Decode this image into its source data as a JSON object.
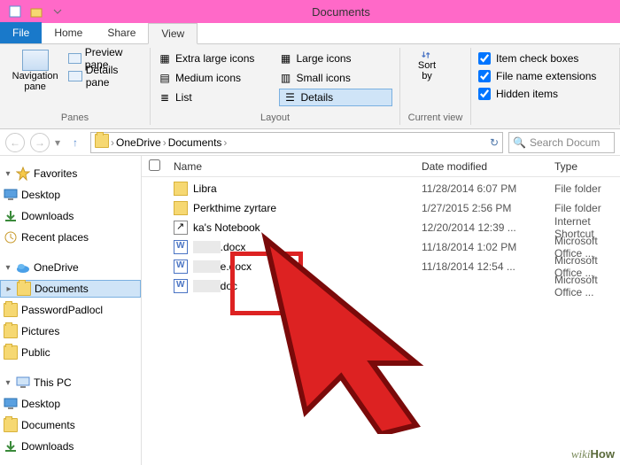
{
  "window_title": "Documents",
  "tabs": {
    "file": "File",
    "home": "Home",
    "share": "Share",
    "view": "View"
  },
  "ribbon": {
    "panes": {
      "nav": "Navigation\npane",
      "preview": "Preview pane",
      "details": "Details pane",
      "label": "Panes"
    },
    "layout": {
      "xl": "Extra large icons",
      "l": "Large icons",
      "m": "Medium icons",
      "s": "Small icons",
      "list": "List",
      "details": "Details",
      "label": "Layout"
    },
    "current": {
      "sort": "Sort\nby",
      "label": "Current view"
    },
    "show": {
      "itemcheck": "Item check boxes",
      "ext": "File name extensions",
      "hidden": "Hidden items"
    }
  },
  "breadcrumb": {
    "a": "OneDrive",
    "b": "Documents"
  },
  "search_placeholder": "Search Docum",
  "sidebar": {
    "favorites": "Favorites",
    "desktop": "Desktop",
    "downloads": "Downloads",
    "recent": "Recent places",
    "onedrive": "OneDrive",
    "documents": "Documents",
    "passpad": "PasswordPadlocl",
    "pictures": "Pictures",
    "public": "Public",
    "thispc": "This PC",
    "pc_desktop": "Desktop",
    "pc_documents": "Documents",
    "pc_downloads": "Downloads"
  },
  "columns": {
    "name": "Name",
    "date": "Date modified",
    "type": "Type"
  },
  "files": [
    {
      "icon": "folder",
      "name": "Libra",
      "date": "11/28/2014 6:07 PM",
      "type": "File folder"
    },
    {
      "icon": "folder",
      "name": "Perkthime zyrtare",
      "date": "1/27/2015 2:56 PM",
      "type": "File folder"
    },
    {
      "icon": "link",
      "name": "ka's Notebook",
      "date": "12/20/2014 12:39 ...",
      "type": "Internet Shortcut"
    },
    {
      "icon": "doc",
      "name_prefix": "",
      "name_suffix": ".docx",
      "date": "11/18/2014 1:02 PM",
      "type": "Microsoft Office ..."
    },
    {
      "icon": "doc",
      "name_prefix": "",
      "name_suffix": "e.docx",
      "date": "11/18/2014 12:54 ...",
      "type": "Microsoft Office ..."
    },
    {
      "icon": "doc",
      "name_prefix": "",
      "name_suffix": "doc",
      "date": "",
      "type": "Microsoft Office ..."
    }
  ],
  "watermark": "wikiHow"
}
